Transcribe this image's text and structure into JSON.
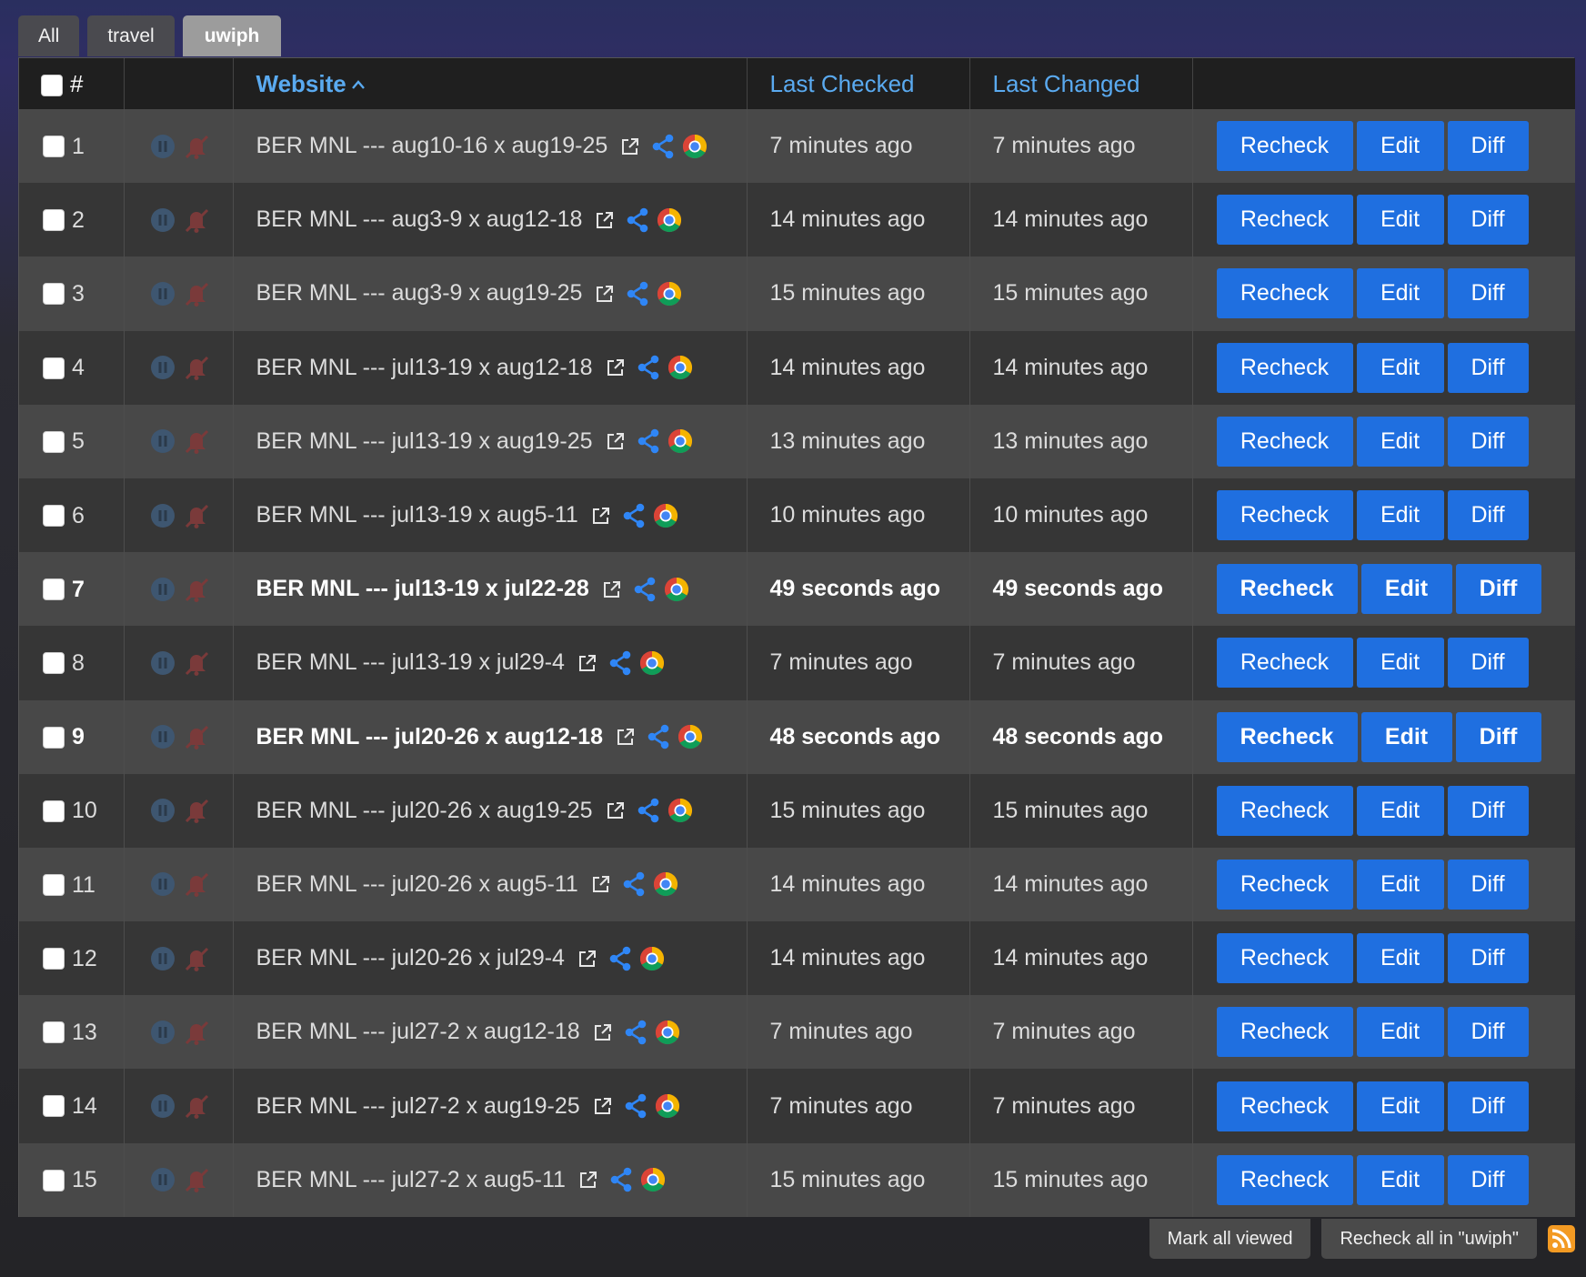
{
  "tabs": [
    {
      "label": "All",
      "active": false
    },
    {
      "label": "travel",
      "active": false
    },
    {
      "label": "uwiph",
      "active": true
    }
  ],
  "header": {
    "num": "#",
    "website": "Website",
    "last_checked": "Last Checked",
    "last_changed": "Last Changed"
  },
  "buttons": {
    "recheck": "Recheck",
    "edit": "Edit",
    "diff": "Diff"
  },
  "rows": [
    {
      "num": "1",
      "title": "BER MNL --- aug10-16 x aug19-25",
      "checked": "7 minutes ago",
      "changed": "7 minutes ago",
      "bold": false
    },
    {
      "num": "2",
      "title": "BER MNL --- aug3-9 x aug12-18",
      "checked": "14 minutes ago",
      "changed": "14 minutes ago",
      "bold": false
    },
    {
      "num": "3",
      "title": "BER MNL --- aug3-9 x aug19-25",
      "checked": "15 minutes ago",
      "changed": "15 minutes ago",
      "bold": false
    },
    {
      "num": "4",
      "title": "BER MNL --- jul13-19 x aug12-18",
      "checked": "14 minutes ago",
      "changed": "14 minutes ago",
      "bold": false
    },
    {
      "num": "5",
      "title": "BER MNL --- jul13-19 x aug19-25",
      "checked": "13 minutes ago",
      "changed": "13 minutes ago",
      "bold": false
    },
    {
      "num": "6",
      "title": "BER MNL --- jul13-19 x aug5-11",
      "checked": "10 minutes ago",
      "changed": "10 minutes ago",
      "bold": false
    },
    {
      "num": "7",
      "title": "BER MNL --- jul13-19 x jul22-28",
      "checked": "49 seconds ago",
      "changed": "49 seconds ago",
      "bold": true
    },
    {
      "num": "8",
      "title": "BER MNL --- jul13-19 x jul29-4",
      "checked": "7 minutes ago",
      "changed": "7 minutes ago",
      "bold": false
    },
    {
      "num": "9",
      "title": "BER MNL --- jul20-26 x aug12-18",
      "checked": "48 seconds ago",
      "changed": "48 seconds ago",
      "bold": true
    },
    {
      "num": "10",
      "title": "BER MNL --- jul20-26 x aug19-25",
      "checked": "15 minutes ago",
      "changed": "15 minutes ago",
      "bold": false
    },
    {
      "num": "11",
      "title": "BER MNL --- jul20-26 x aug5-11",
      "checked": "14 minutes ago",
      "changed": "14 minutes ago",
      "bold": false
    },
    {
      "num": "12",
      "title": "BER MNL --- jul20-26 x jul29-4",
      "checked": "14 minutes ago",
      "changed": "14 minutes ago",
      "bold": false
    },
    {
      "num": "13",
      "title": "BER MNL --- jul27-2 x aug12-18",
      "checked": "7 minutes ago",
      "changed": "7 minutes ago",
      "bold": false
    },
    {
      "num": "14",
      "title": "BER MNL --- jul27-2 x aug19-25",
      "checked": "7 minutes ago",
      "changed": "7 minutes ago",
      "bold": false
    },
    {
      "num": "15",
      "title": "BER MNL --- jul27-2 x aug5-11",
      "checked": "15 minutes ago",
      "changed": "15 minutes ago",
      "bold": false
    }
  ],
  "footer": {
    "mark_all_viewed": "Mark all viewed",
    "recheck_all": "Recheck all in \"uwiph\""
  },
  "icons": {
    "pause": "pause-icon",
    "mute": "bell-slash-icon",
    "external": "external-link-icon",
    "share": "share-icon",
    "browser": "chrome-icon",
    "feed": "rss-icon"
  },
  "colors": {
    "accent": "#1f6fe0",
    "header_link": "#5aaaf0",
    "active_tab": "#9c9c9c",
    "mute_icon": "#7a3a3a",
    "pause_icon": "#3e5670"
  }
}
